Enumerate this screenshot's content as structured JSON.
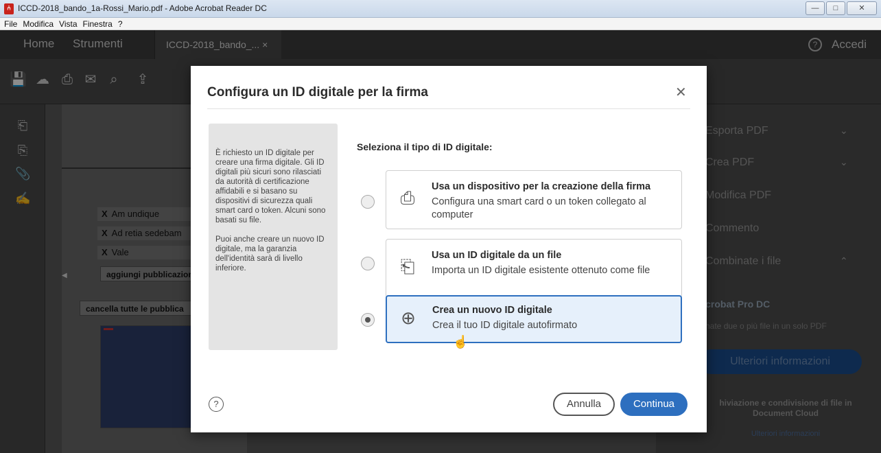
{
  "window": {
    "title": "ICCD-2018_bando_1a-Rossi_Mario.pdf - Adobe Acrobat Reader DC",
    "app_icon_glyph": "⑃",
    "controls": [
      "—",
      "□",
      "✕"
    ]
  },
  "menu": [
    "File",
    "Modifica",
    "Vista",
    "Finestra",
    "?"
  ],
  "tabs": {
    "home": "Home",
    "tools": "Strumenti",
    "document": "ICCD-2018_bando_...  ×",
    "help_glyph": "?",
    "sign_in": "Accedi"
  },
  "toolbar_icons": [
    "save-icon",
    "upload-cloud-icon",
    "print-icon",
    "email-icon",
    "search-icon",
    "share-icon"
  ],
  "toolbar_glyphs": [
    "💾",
    "☁",
    "⎙",
    "✉",
    "⌕",
    "⇪"
  ],
  "left_rail_glyphs": [
    "⎗",
    "⎘",
    "📎",
    "✍"
  ],
  "document": {
    "rows": [
      {
        "mark": "X",
        "text": "Am undique"
      },
      {
        "mark": "X",
        "text": "Ad retia sedebam"
      },
      {
        "mark": "X",
        "text": "Vale"
      }
    ],
    "add_button": "aggiungi pubblicazione",
    "clear_button": "cancella tutte le pubblica",
    "scroll_left": "◀"
  },
  "right_panel": {
    "items": [
      {
        "label": "Esporta PDF",
        "chevron": "⌄"
      },
      {
        "label": "Crea PDF",
        "chevron": "⌄"
      },
      {
        "label": "Modifica PDF",
        "chevron": ""
      },
      {
        "label": "Commento",
        "chevron": ""
      },
      {
        "label": "Combinate i file",
        "chevron": "⌃"
      }
    ],
    "promo_title": "Acrobat Pro DC",
    "promo_text": "nate due o più file in un solo PDF",
    "promo_button": "Ulteriori informazioni",
    "dc_text": "hiviazione e condivisione di file in Document Cloud",
    "dc_link": "Ulteriori informazioni"
  },
  "dialog": {
    "title": "Configura un ID digitale per la firma",
    "close_glyph": "✕",
    "info_paragraph_1": "È richiesto un ID digitale per creare una firma digitale. Gli ID digitali più sicuri sono rilasciati da autorità di certificazione affidabili e si basano su dispositivi di sicurezza quali smart card o token. Alcuni sono basati su file.",
    "info_paragraph_2": "Puoi anche creare un nuovo ID digitale, ma la garanzia dell'identità sarà di livello inferiore.",
    "section_label": "Seleziona il tipo di ID digitale:",
    "options": [
      {
        "title": "Usa un dispositivo per la creazione della firma",
        "description": "Configura una smart card o un token collegato al computer",
        "icon": "⎙",
        "selected": false
      },
      {
        "title": "Usa un ID digitale da un file",
        "description": "Importa un ID digitale esistente ottenuto come file",
        "icon": "⎗",
        "selected": false
      },
      {
        "title": "Crea un nuovo ID digitale",
        "description": "Crea il tuo ID digitale autofirmato",
        "icon": "⊕",
        "selected": true
      }
    ],
    "help_glyph": "?",
    "cancel_label": "Annulla",
    "continue_label": "Continua",
    "cursor_glyph": "☝"
  },
  "colors": {
    "accent": "#2d6fbf",
    "selected_bg": "#e6f0fb",
    "chrome_dark": "#3c3c3c",
    "pdf_icon": "#c8231c"
  }
}
